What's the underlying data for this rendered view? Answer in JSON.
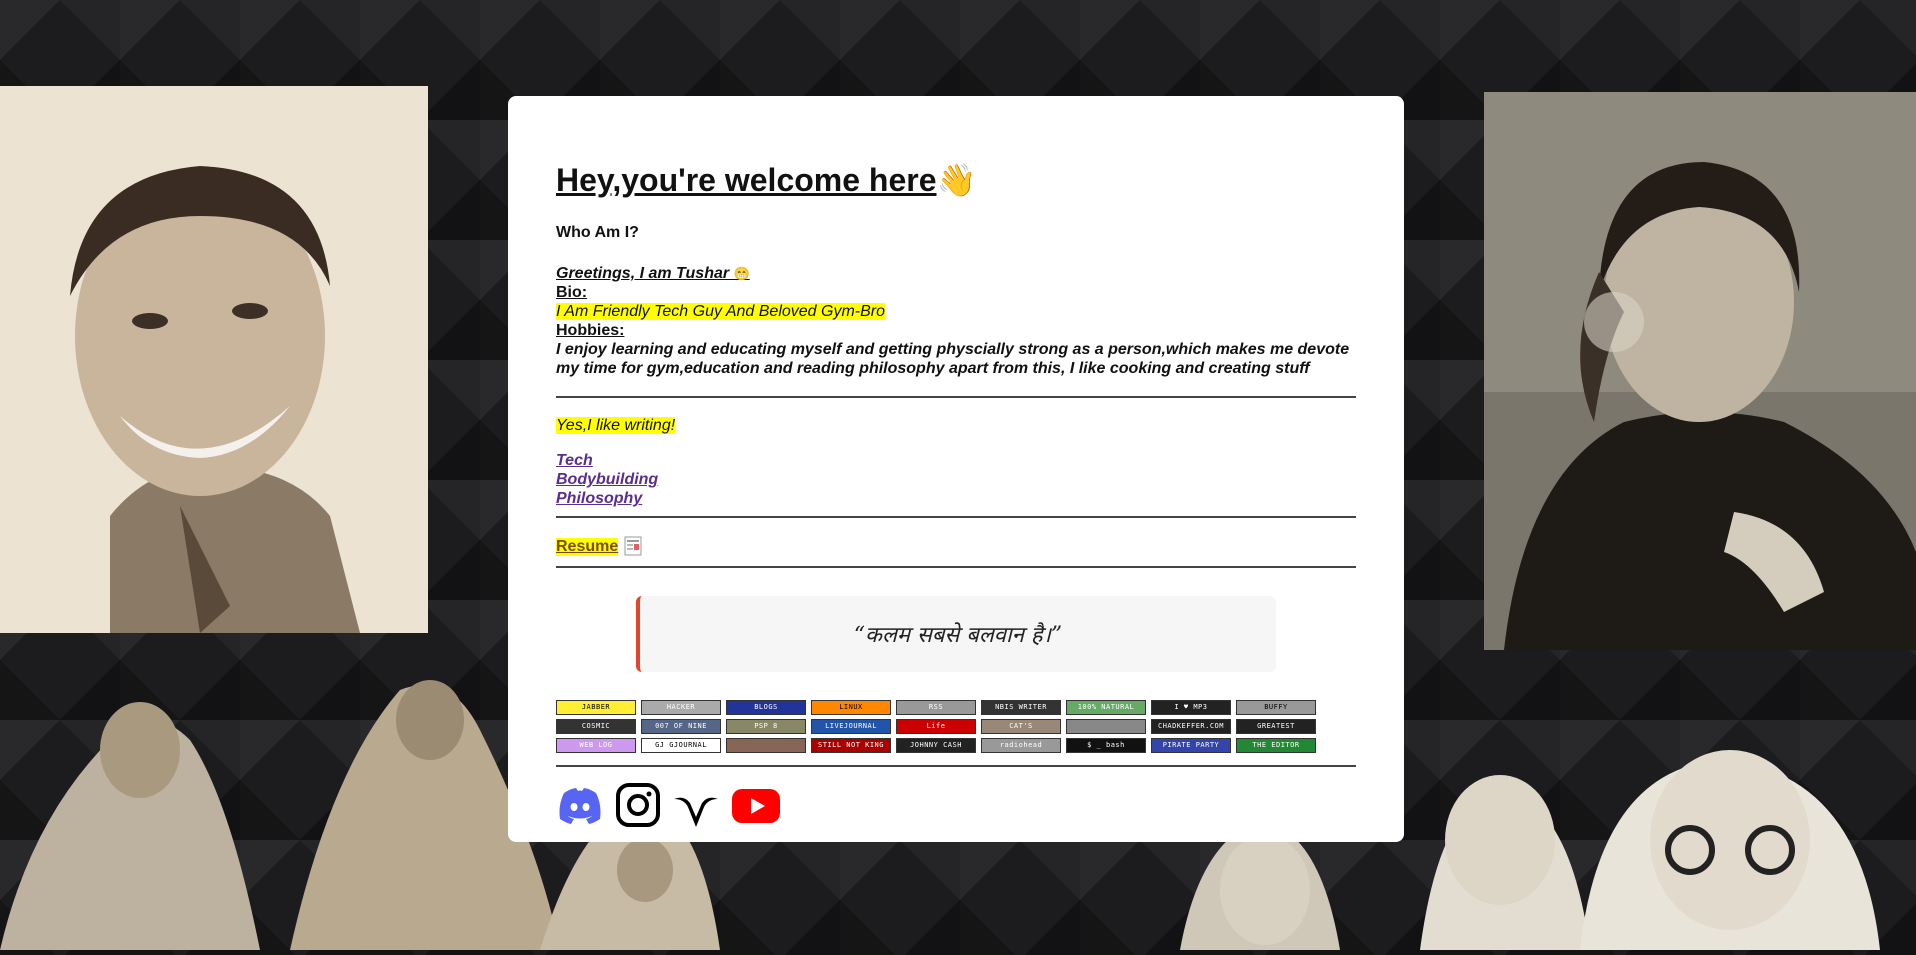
{
  "header": {
    "title": "Hey,you're welcome here",
    "wave_emoji": "👋"
  },
  "intro": {
    "who_heading": "Who Am I?",
    "greeting": "Greetings, I am Tushar ",
    "greeting_emoji": "😁",
    "bio_label": "Bio:",
    "bio_text": "I Am Friendly Tech Guy And Beloved Gym-Bro",
    "hobbies_label": "Hobbies:",
    "hobbies_text": "I enjoy learning and educating myself and getting physcially strong as a person,which makes me devote my time for gym,education and reading philosophy apart from this, I like cooking and creating stuff"
  },
  "writing": {
    "heading": "Yes,I like writing!",
    "links": [
      "Tech",
      "Bodybuilding",
      "Philosophy"
    ]
  },
  "resume": {
    "label": "Resume",
    "icon": "document-icon"
  },
  "quote": {
    "text": "“कलम सबसे बलवान है।”"
  },
  "badges": [
    {
      "text": "JABBER",
      "bg": "#ffee33",
      "fg": "#000"
    },
    {
      "text": "HACKER",
      "bg": "#aaaaaa",
      "fg": "#fff"
    },
    {
      "text": "BLOGS",
      "bg": "#223399",
      "fg": "#fff"
    },
    {
      "text": "LINUX",
      "bg": "#ff8800",
      "fg": "#000"
    },
    {
      "text": "RSS",
      "bg": "#999999",
      "fg": "#fff"
    },
    {
      "text": "NBIS WRITER",
      "bg": "#333333",
      "fg": "#fff"
    },
    {
      "text": "100% NATURAL",
      "bg": "#66aa66",
      "fg": "#fff"
    },
    {
      "text": "I ♥ MP3",
      "bg": "#222222",
      "fg": "#fff"
    },
    {
      "text": "BUFFY",
      "bg": "#999999",
      "fg": "#000"
    },
    {
      "text": "COSMIC",
      "bg": "#333333",
      "fg": "#fff"
    },
    {
      "text": "007 OF NINE",
      "bg": "#556688",
      "fg": "#fff"
    },
    {
      "text": "PSP 8",
      "bg": "#888866",
      "fg": "#fff"
    },
    {
      "text": "LIVEJOURNAL",
      "bg": "#2255aa",
      "fg": "#fff"
    },
    {
      "text": "Life",
      "bg": "#cc0000",
      "fg": "#fff"
    },
    {
      "text": "CAT'S",
      "bg": "#998877",
      "fg": "#fff"
    },
    {
      "text": "",
      "bg": "#888888",
      "fg": "#fff"
    },
    {
      "text": "CHADKEFFER.COM",
      "bg": "#222222",
      "fg": "#fff"
    },
    {
      "text": "GREATEST",
      "bg": "#222222",
      "fg": "#fff"
    },
    {
      "text": "WEB LOG",
      "bg": "#cc99ee",
      "fg": "#fff"
    },
    {
      "text": "GJ GJOURNAL",
      "bg": "#ffffff",
      "fg": "#000"
    },
    {
      "text": "",
      "bg": "#886655",
      "fg": "#fff"
    },
    {
      "text": "STILL NOT KING",
      "bg": "#aa0000",
      "fg": "#fff"
    },
    {
      "text": "JOHNNY CASH",
      "bg": "#222222",
      "fg": "#fff"
    },
    {
      "text": "radiohead",
      "bg": "#999999",
      "fg": "#fff"
    },
    {
      "text": "$ _ bash",
      "bg": "#111111",
      "fg": "#fff"
    },
    {
      "text": "PIRATE PARTY",
      "bg": "#3344aa",
      "fg": "#fff"
    },
    {
      "text": "THE EDITOR",
      "bg": "#228833",
      "fg": "#fff"
    }
  ],
  "social": [
    {
      "name": "discord-icon",
      "color": "#5865f2"
    },
    {
      "name": "instagram-icon",
      "color": "#000000"
    },
    {
      "name": "vuejs-style-v-icon",
      "color": "#000000"
    },
    {
      "name": "youtube-icon",
      "color": "#ff0000"
    }
  ]
}
